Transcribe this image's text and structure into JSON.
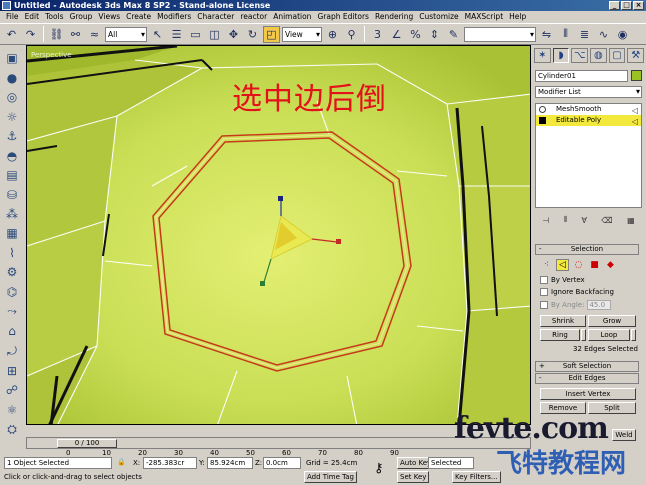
{
  "title": "Untitled - Autodesk 3ds Max 8 SP2  - Stand-alone License",
  "menu": [
    "File",
    "Edit",
    "Tools",
    "Group",
    "Views",
    "Create",
    "Modifiers",
    "Character",
    "reactor",
    "Animation",
    "Graph Editors",
    "Rendering",
    "Customize",
    "MAXScript",
    "Help"
  ],
  "toolbar": {
    "selection_filter": "All",
    "ref_coord": "View"
  },
  "viewport": {
    "label": "Perspective",
    "caption": "选中边后倒"
  },
  "command_panel": {
    "object_name": "Cylinder01",
    "modifier_list": "Modifier List",
    "stack": [
      "MeshSmooth",
      "Editable Poly"
    ],
    "selection": {
      "title": "Selection",
      "by_vertex": "By Vertex",
      "ignore_backfacing": "Ignore Backfacing",
      "by_angle": "By Angle:",
      "angle_value": "45.0",
      "shrink": "Shrink",
      "grow": "Grow",
      "ring": "Ring",
      "loop": "Loop",
      "info": "32 Edges Selected"
    },
    "soft_selection": "Soft Selection",
    "edit_edges": {
      "title": "Edit Edges",
      "insert_vertex": "Insert Vertex",
      "remove": "Remove",
      "split": "Split",
      "weld": "Weld"
    }
  },
  "timeline": {
    "slider": "0 / 100",
    "ticks": [
      "0",
      "10",
      "20",
      "30",
      "40",
      "50",
      "60",
      "70",
      "80",
      "90"
    ]
  },
  "status": {
    "selected": "1 Object Selected",
    "prompt": "Click or click-and-drag to select objects",
    "x_label": "X:",
    "x_value": "-285.383cr",
    "y_label": "Y:",
    "y_value": "85.924cm",
    "z_label": "Z:",
    "z_value": "0.0cm",
    "grid": "Grid = 25.4cm",
    "add_time_tag": "Add Time Tag",
    "auto_key": "Auto Key",
    "auto_key_mode": "Selected",
    "set_key": "Set Key",
    "key_filters": "Key Filters..."
  },
  "watermark": {
    "line1": "fevte.com",
    "line2": "飞特教程网"
  },
  "colors": {
    "viewport_face": "#c9de55",
    "selected_edge": "#c63a1a",
    "highlight": "#f2e93c"
  }
}
